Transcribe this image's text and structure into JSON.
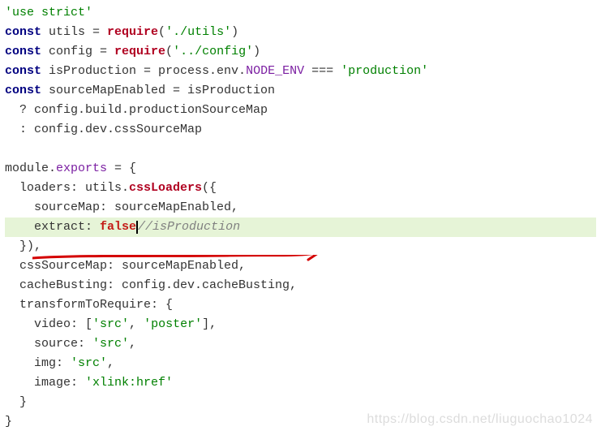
{
  "code": {
    "l1": {
      "s1": "'use strict'"
    },
    "l2": {
      "kw": "const",
      "v": " utils = ",
      "req": "require",
      "p1": "(",
      "s": "'./utils'",
      "p2": ")"
    },
    "l3": {
      "kw": "const",
      "v": " config = ",
      "req": "require",
      "p1": "(",
      "s": "'../config'",
      "p2": ")"
    },
    "l4": {
      "kw": "const",
      "v": " isProduction = process.env.",
      "env": "NODE_ENV",
      "eq": " === ",
      "s": "'production'"
    },
    "l5": {
      "kw": "const",
      "v": " sourceMapEnabled = isProduction"
    },
    "l6": {
      "pre": "  ? config.build.productionSourceMap"
    },
    "l7": {
      "pre": "  : config.dev.cssSourceMap"
    },
    "l9": {
      "a": "module.",
      "b": "exports",
      "c": " = {"
    },
    "l10": {
      "pre": "  loaders: utils.",
      "m": "cssLoaders",
      "p": "({"
    },
    "l11": {
      "pre": "    sourceMap: sourceMapEnabled,"
    },
    "l12": {
      "pre": "    extract: ",
      "val": "false",
      "cmt": "//isProduction"
    },
    "l13": {
      "pre": "  }),"
    },
    "l14": {
      "pre": "  cssSourceMap: sourceMapEnabled,"
    },
    "l15": {
      "pre": "  cacheBusting: config.dev.cacheBusting,"
    },
    "l16": {
      "pre": "  transformToRequire: {"
    },
    "l17": {
      "pre": "    video: [",
      "s1": "'src'",
      "c": ", ",
      "s2": "'poster'",
      "end": "],"
    },
    "l18": {
      "pre": "    source: ",
      "s": "'src'",
      "end": ","
    },
    "l19": {
      "pre": "    img: ",
      "s": "'src'",
      "end": ","
    },
    "l20": {
      "pre": "    image: ",
      "s": "'xlink:href'"
    },
    "l21": {
      "pre": "  }"
    },
    "l22": {
      "pre": "}"
    }
  },
  "watermark": "https://blog.csdn.net/liuguochao1024"
}
